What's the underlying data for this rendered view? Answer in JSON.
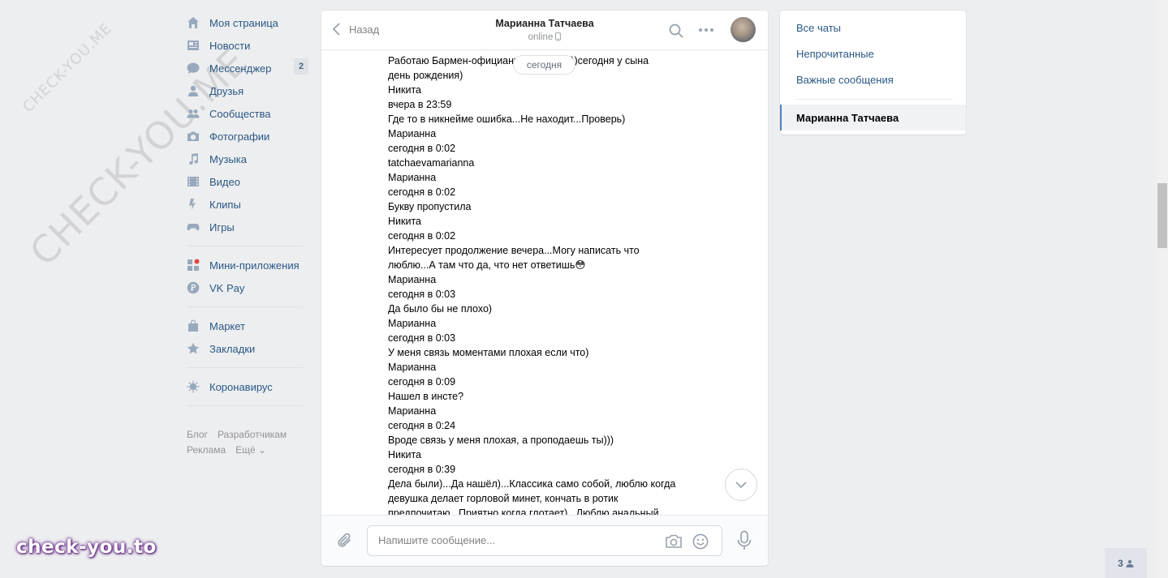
{
  "watermark": {
    "small": "CHECK-YOU.ME",
    "large": "CHECK-YOU.ME"
  },
  "nav": {
    "items": [
      {
        "label": "Моя страница",
        "icon": "home-icon"
      },
      {
        "label": "Новости",
        "icon": "news-icon"
      },
      {
        "label": "Мессенджер",
        "icon": "messenger-icon",
        "badge": "2"
      },
      {
        "label": "Друзья",
        "icon": "friends-icon"
      },
      {
        "label": "Сообщества",
        "icon": "communities-icon"
      },
      {
        "label": "Фотографии",
        "icon": "camera-icon"
      },
      {
        "label": "Музыка",
        "icon": "music-icon"
      },
      {
        "label": "Видео",
        "icon": "video-icon"
      },
      {
        "label": "Клипы",
        "icon": "clips-icon"
      },
      {
        "label": "Игры",
        "icon": "games-icon"
      }
    ],
    "group2": [
      {
        "label": "Мини-приложения",
        "icon": "mini-apps-icon"
      },
      {
        "label": "VK Pay",
        "icon": "vkpay-icon"
      }
    ],
    "group3": [
      {
        "label": "Маркет",
        "icon": "market-icon"
      },
      {
        "label": "Закладки",
        "icon": "bookmarks-icon"
      }
    ],
    "group4": [
      {
        "label": "Коронавирус",
        "icon": "virus-icon"
      }
    ],
    "footer": {
      "blog": "Блог",
      "developers": "Разработчикам",
      "ads": "Реклама",
      "more": "Ещё ⌄"
    }
  },
  "chat": {
    "back_label": "Назад",
    "peer_name": "Марианна Татчаева",
    "peer_status": "online",
    "date_divider": "сегодня",
    "lines": [
      "Работаю Бармен-официант(честь 2-ое))сегодня у сына",
      "день рождения)",
      "Никита",
      "вчера в 23:59",
      "Где то в никнейме ошибка...Не находит...Проверь)",
      "Марианна",
      "сегодня в 0:02",
      "tatchaevamarianna",
      "Марианна",
      "сегодня в 0:02",
      "Букву пропустила",
      "Никита",
      "сегодня в 0:02",
      "Интересует продолжение вечера...Могу написать что",
      "люблю...А там что да, что нет ответишь😳",
      "Марианна",
      "сегодня в 0:03",
      "Да было бы не плохо)",
      "Марианна",
      "сегодня в 0:03",
      "У меня связь моментами плохая если что)",
      "Марианна",
      "сегодня в 0:09",
      "Нашел в инсте?",
      "Марианна",
      "сегодня в 0:24",
      "Вроде связь у меня плохая, а проподаешь ты)))",
      "Никита",
      "сегодня в 0:39",
      "Дела были)...Да нашёл)...Классика само собой, люблю когда",
      "девушка делает горловой минет, кончать в ротик",
      "предпочитаю...Приятно когда глотает)...Люблю анальный"
    ],
    "composer_placeholder": "Напишите сообщение..."
  },
  "right_panel": {
    "all_chats": "Все чаты",
    "unread": "Непрочитанные",
    "important": "Важные сообщения",
    "active_chat": "Марианна Татчаева"
  },
  "online_count": "3",
  "brand": "check-you.to",
  "colors": {
    "link": "#2a5885",
    "accent": "#5181b8",
    "background": "#edeef0"
  }
}
